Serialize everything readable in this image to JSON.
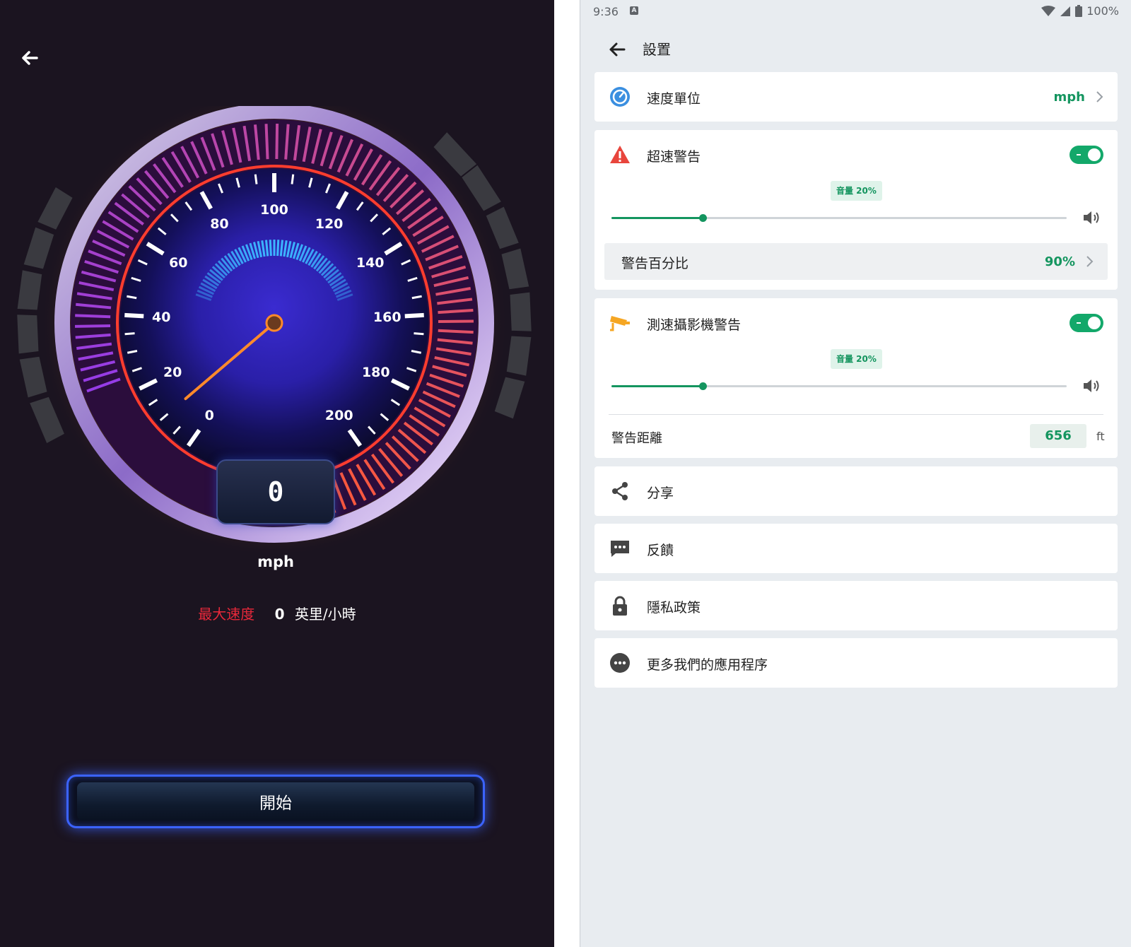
{
  "speedometer": {
    "current_speed": "0",
    "unit": "mph",
    "tick_labels": [
      "0",
      "20",
      "40",
      "60",
      "80",
      "100",
      "120",
      "140",
      "160",
      "180",
      "200"
    ],
    "needle_value": 10,
    "max_speed_label": "最大速度",
    "max_speed_value": "0",
    "max_speed_unit": "英里/小時",
    "start_button": "開始"
  },
  "status_bar": {
    "time": "9:36",
    "notification_icon": "A",
    "battery": "100%"
  },
  "settings": {
    "title": "設置",
    "speed_unit": {
      "label": "速度單位",
      "value": "mph"
    },
    "overspeed_warning": {
      "label": "超速警告",
      "enabled": true,
      "volume_badge": "音量 20%",
      "volume": 0.2,
      "percent_label": "警告百分比",
      "percent_value": "90%"
    },
    "camera_warning": {
      "label": "測速攝影機警告",
      "enabled": true,
      "volume_badge": "音量 20%",
      "volume": 0.2,
      "distance_label": "警告距離",
      "distance_value": "656",
      "distance_unit": "ft"
    },
    "share": "分享",
    "feedback": "反饋",
    "privacy": "隱私政策",
    "more_apps": "更多我們的應用程序"
  },
  "colors": {
    "accent_green": "#13a86a",
    "warning_red": "#e8283a",
    "icon_blue": "#3b8fe0",
    "camera_orange": "#f5a623"
  }
}
